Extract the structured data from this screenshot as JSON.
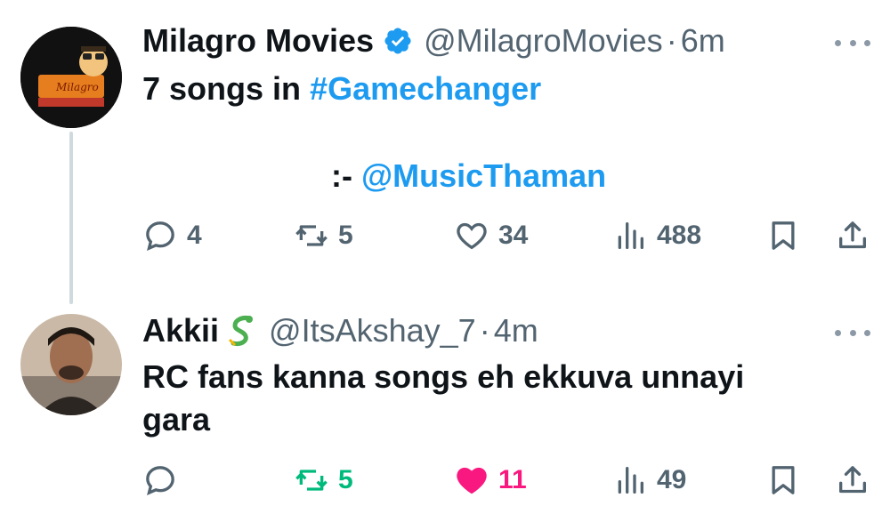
{
  "tweets": [
    {
      "display_name": "Milagro Movies",
      "verified": true,
      "handle": "@MilagroMovies",
      "separator": "·",
      "time": "6m",
      "avatar_text": "Milagro",
      "text_line1_prefix": "7 songs in ",
      "text_line1_hashtag": "#Gamechanger",
      "text_line2_prefix": ":- ",
      "text_line2_mention": "@MusicThaman",
      "stats": {
        "replies": "4",
        "retweets": "5",
        "likes": "34",
        "views": "488"
      },
      "retweeted": false,
      "liked": false
    },
    {
      "display_name": "Akkii",
      "badge_emoji": "dragon",
      "handle": "@ItsAkshay_7",
      "separator": "·",
      "time": "4m",
      "text_line1": "RC fans kanna songs eh ekkuva unnayi",
      "text_line2": "gara",
      "stats": {
        "replies": "",
        "retweets": "5",
        "likes": "11",
        "views": "49"
      },
      "retweeted": true,
      "liked": true
    }
  ],
  "colors": {
    "link": "#1d9bf0",
    "muted": "#536471",
    "retweet": "#00ba7c",
    "like": "#f91880"
  }
}
